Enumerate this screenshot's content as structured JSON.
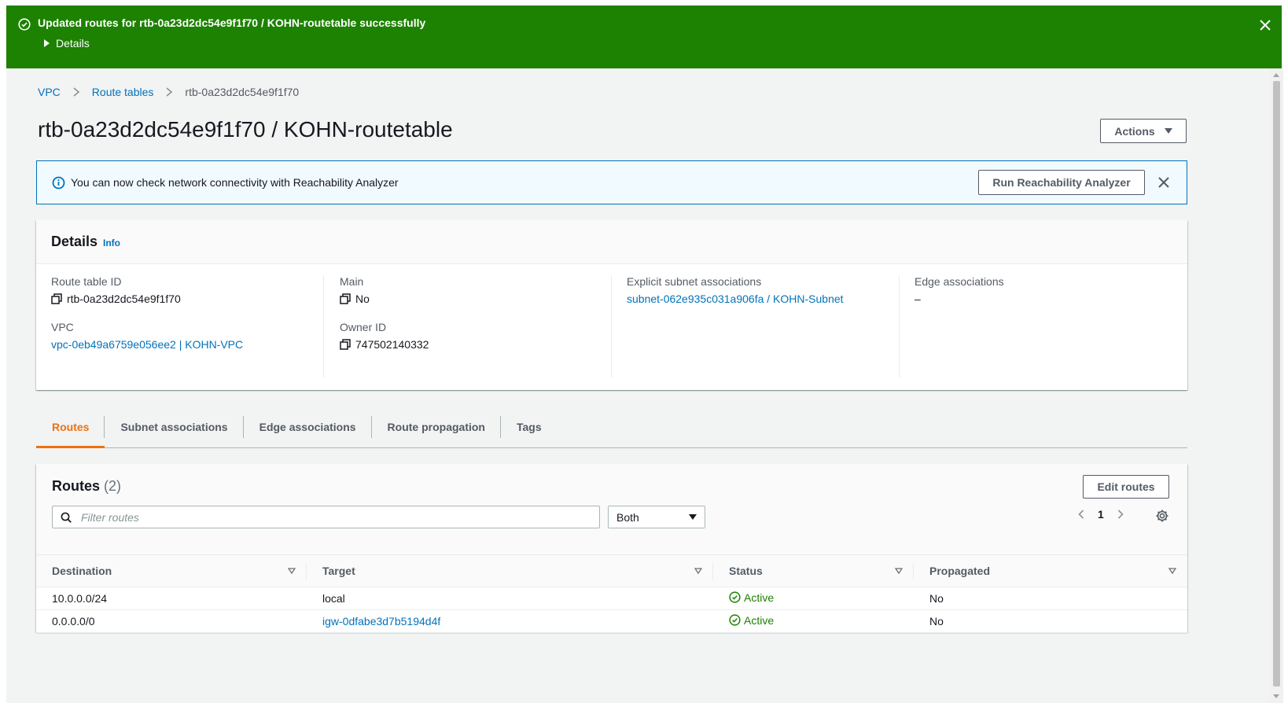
{
  "flash": {
    "message": "Updated routes for rtb-0a23d2dc54e9f1f70 / KOHN-routetable successfully",
    "details_label": "Details",
    "color": "#1d8102"
  },
  "breadcrumb": {
    "items": [
      "VPC",
      "Route tables",
      "rtb-0a23d2dc54e9f1f70"
    ]
  },
  "page": {
    "title": "rtb-0a23d2dc54e9f1f70 / KOHN-routetable",
    "actions_label": "Actions"
  },
  "info_alert": {
    "text": "You can now check network connectivity with Reachability Analyzer",
    "button_label": "Run Reachability Analyzer"
  },
  "details": {
    "heading": "Details",
    "info_link": "Info",
    "route_table_id": {
      "label": "Route table ID",
      "value": "rtb-0a23d2dc54e9f1f70"
    },
    "vpc": {
      "label": "VPC",
      "value": "vpc-0eb49a6759e056ee2 | KOHN-VPC"
    },
    "main": {
      "label": "Main",
      "value": "No"
    },
    "owner_id": {
      "label": "Owner ID",
      "value": "747502140332"
    },
    "explicit_subnet": {
      "label": "Explicit subnet associations",
      "value": "subnet-062e935c031a906fa / KOHN-Subnet"
    },
    "edge": {
      "label": "Edge associations",
      "value": "–"
    }
  },
  "tabs": [
    {
      "label": "Routes",
      "active": true
    },
    {
      "label": "Subnet associations",
      "active": false
    },
    {
      "label": "Edge associations",
      "active": false
    },
    {
      "label": "Route propagation",
      "active": false
    },
    {
      "label": "Tags",
      "active": false
    }
  ],
  "routes": {
    "heading": "Routes",
    "count": "(2)",
    "edit_label": "Edit routes",
    "filter_placeholder": "Filter routes",
    "select_value": "Both",
    "page_number": "1",
    "columns": [
      "Destination",
      "Target",
      "Status",
      "Propagated"
    ],
    "rows": [
      {
        "destination": "10.0.0.0/24",
        "target": "local",
        "target_is_link": false,
        "status": "Active",
        "propagated": "No"
      },
      {
        "destination": "0.0.0.0/0",
        "target": "igw-0dfabe3d7b5194d4f",
        "target_is_link": true,
        "status": "Active",
        "propagated": "No"
      }
    ]
  },
  "colors": {
    "link": "#0073bb",
    "accent_orange": "#ec7211",
    "success": "#1d8102"
  }
}
